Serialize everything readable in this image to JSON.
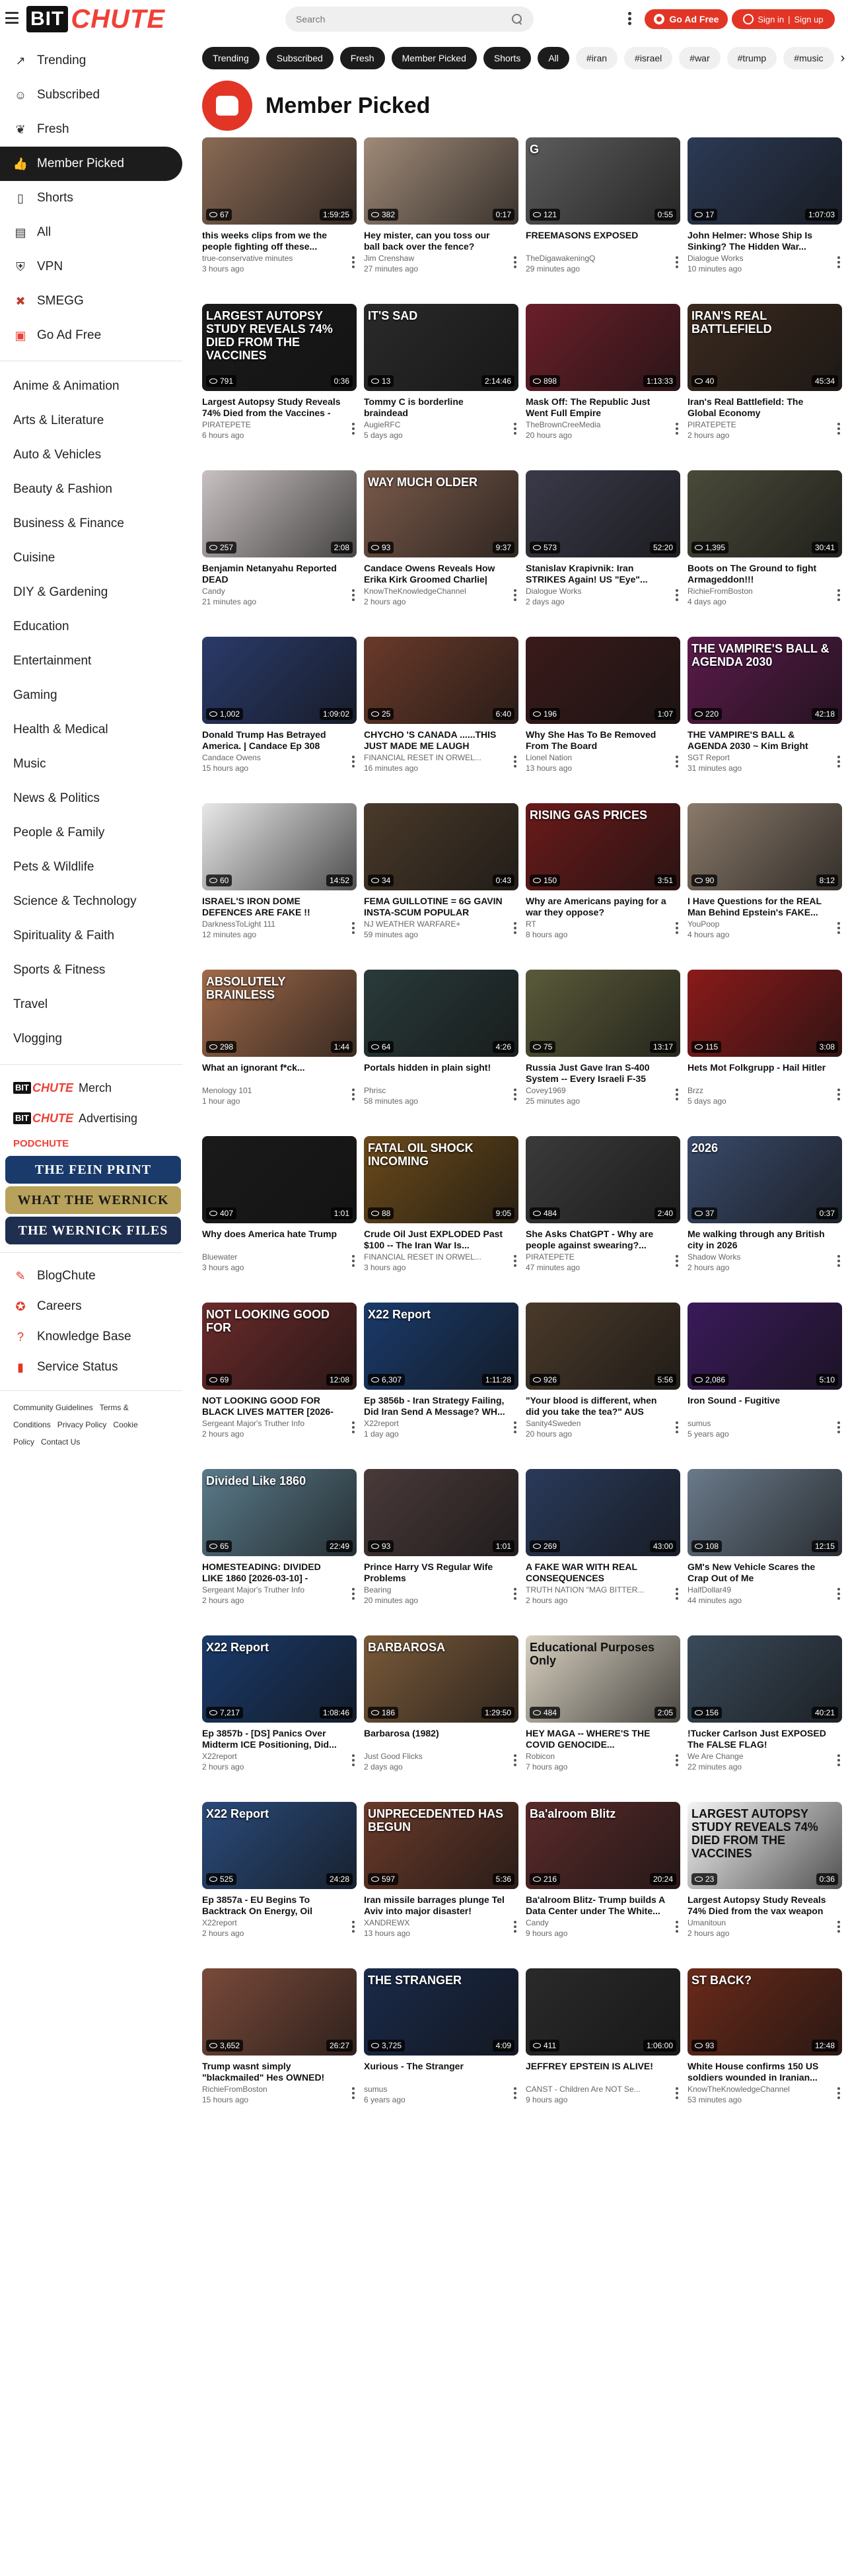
{
  "header": {
    "search_placeholder": "Search",
    "go_ad_free": "Go Ad Free",
    "sign_in": "Sign in",
    "separator": "|",
    "sign_up": "Sign up",
    "logo_text_a": "BIT",
    "logo_text_b": "CHUTE"
  },
  "sidebar": {
    "nav": [
      {
        "label": "Trending",
        "icon": "trending-icon"
      },
      {
        "label": "Subscribed",
        "icon": "person-icon"
      },
      {
        "label": "Fresh",
        "icon": "leaf-icon"
      },
      {
        "label": "Member Picked",
        "icon": "thumbs-up-icon"
      },
      {
        "label": "Shorts",
        "icon": "phone-icon"
      },
      {
        "label": "All",
        "icon": "document-icon"
      },
      {
        "label": "VPN",
        "icon": "shield-icon"
      },
      {
        "label": "SMEGG",
        "icon": "smegg-logo-icon"
      },
      {
        "label": "Go Ad Free",
        "icon": "bitchute-logo-icon"
      }
    ],
    "categories": [
      "Anime & Animation",
      "Arts & Literature",
      "Auto & Vehicles",
      "Beauty & Fashion",
      "Business & Finance",
      "Cuisine",
      "DIY & Gardening",
      "Education",
      "Entertainment",
      "Gaming",
      "Health & Medical",
      "Music",
      "News & Politics",
      "People & Family",
      "Pets & Wildlife",
      "Science & Technology",
      "Spirituality & Faith",
      "Sports & Fitness",
      "Travel",
      "Vlogging"
    ],
    "brand_links": [
      {
        "label": "Merch"
      },
      {
        "label": "Advertising"
      }
    ],
    "podchute": "PODCHUTE",
    "banners": [
      {
        "label": "THE FEIN PRINT",
        "color": "#1a3a6b"
      },
      {
        "label": "WHAT THE WERNICK",
        "color": "#b8a15a"
      },
      {
        "label": "THE WERNICK FILES",
        "color": "#1f2f4f"
      }
    ],
    "bottom_links": [
      {
        "label": "BlogChute",
        "icon": "blog-icon"
      },
      {
        "label": "Careers",
        "icon": "careers-icon"
      },
      {
        "label": "Knowledge Base",
        "icon": "help-icon"
      },
      {
        "label": "Service Status",
        "icon": "status-bars-icon"
      }
    ],
    "footer": [
      "Community Guidelines",
      "Terms & Conditions",
      "Privacy Policy",
      "Cookie Policy",
      "Contact Us"
    ]
  },
  "chips": [
    {
      "label": "Trending",
      "style": "dark"
    },
    {
      "label": "Subscribed",
      "style": "dark"
    },
    {
      "label": "Fresh",
      "style": "dark"
    },
    {
      "label": "Member Picked",
      "style": "dark"
    },
    {
      "label": "Shorts",
      "style": "dark"
    },
    {
      "label": "All",
      "style": "dark"
    },
    {
      "label": "#iran",
      "style": "plain"
    },
    {
      "label": "#israel",
      "style": "plain"
    },
    {
      "label": "#war",
      "style": "plain"
    },
    {
      "label": "#trump",
      "style": "plain"
    },
    {
      "label": "#music",
      "style": "plain"
    }
  ],
  "page_title": "Member Picked",
  "colors": {
    "accent": "#e23526",
    "dark": "#1c1c1c"
  },
  "videos": [
    {
      "title": "this weeks clips from we the people fighting off these...",
      "channel": "true-conservative minutes",
      "time": "3 hours ago",
      "views": "67",
      "duration": "1:59:25",
      "bg": "#8a6a55",
      "overlay": ""
    },
    {
      "title": "Hey mister, can you toss our ball back over the fence?",
      "channel": "Jim Crenshaw",
      "time": "27 minutes ago",
      "views": "382",
      "duration": "0:17",
      "bg": "#a08a78",
      "overlay": ""
    },
    {
      "title": "FREEMASONS EXPOSED",
      "channel": "TheDigawakeningQ",
      "time": "29 minutes ago",
      "views": "121",
      "duration": "0:55",
      "bg": "#5c5c5c",
      "overlay": "G"
    },
    {
      "title": "John Helmer: Whose Ship Is Sinking? The Hidden War...",
      "channel": "Dialogue Works",
      "time": "10 minutes ago",
      "views": "17",
      "duration": "1:07:03",
      "bg": "#2c3a55",
      "overlay": ""
    },
    {
      "title": "Largest Autopsy Study Reveals 74% Died from the Vaccines - D...",
      "channel": "PIRATEPETE",
      "time": "6 hours ago",
      "views": "791",
      "duration": "0:36",
      "bg": "#1a1a1a",
      "overlay": "LARGEST AUTOPSY STUDY REVEALS 74% DIED FROM THE VACCINES"
    },
    {
      "title": "Tommy C is borderline braindead",
      "channel": "AugieRFC",
      "time": "5 days ago",
      "views": "13",
      "duration": "2:14:46",
      "bg": "#2a2a2a",
      "overlay": "IT'S SAD"
    },
    {
      "title": "Mask Off: The Republic Just Went Full Empire",
      "channel": "TheBrownCreeMedia",
      "time": "20 hours ago",
      "views": "898",
      "duration": "1:13:33",
      "bg": "#6b1f2a",
      "overlay": ""
    },
    {
      "title": "Iran's Real Battlefield: The Global Economy",
      "channel": "PIRATEPETE",
      "time": "2 hours ago",
      "views": "40",
      "duration": "45:34",
      "bg": "#3b2a1f",
      "overlay": "IRAN'S REAL BATTLEFIELD"
    },
    {
      "title": "Benjamin Netanyahu Reported DEAD",
      "channel": "Candy",
      "time": "21 minutes ago",
      "views": "257",
      "duration": "2:08",
      "bg": "#c9c1c1",
      "overlay": ""
    },
    {
      "title": "Candace Owens Reveals How Erika Kirk Groomed Charlie| Eri...",
      "channel": "KnowTheKnowledgeChannel",
      "time": "2 hours ago",
      "views": "93",
      "duration": "9:37",
      "bg": "#7a5a4a",
      "overlay": "WAY MUCH OLDER"
    },
    {
      "title": "Stanislav Krapivnik: Iran STRIKES Again! US \"Eye\"...",
      "channel": "Dialogue Works",
      "time": "2 days ago",
      "views": "573",
      "duration": "52:20",
      "bg": "#3a3a4a",
      "overlay": ""
    },
    {
      "title": "Boots on The Ground to fight Armageddon!!!",
      "channel": "RichieFromBoston",
      "time": "4 days ago",
      "views": "1,395",
      "duration": "30:41",
      "bg": "#4a4a3a",
      "overlay": ""
    },
    {
      "title": "Donald Trump Has Betrayed America. | Candace Ep 308",
      "channel": "Candace Owens",
      "time": "15 hours ago",
      "views": "1,002",
      "duration": "1:09:02",
      "bg": "#2a3a6a",
      "overlay": ""
    },
    {
      "title": "CHYCHO 'S CANADA ......THIS JUST MADE ME LAUGH LIVING...",
      "channel": "FINANCIAL RESET IN ORWEL...",
      "time": "16 minutes ago",
      "views": "25",
      "duration": "6:40",
      "bg": "#6a3a2a",
      "overlay": ""
    },
    {
      "title": "Why She Has To Be Removed From The Board",
      "channel": "Lionel Nation",
      "time": "13 hours ago",
      "views": "196",
      "duration": "1:07",
      "bg": "#3a1a1a",
      "overlay": ""
    },
    {
      "title": "THE VAMPIRE'S BALL & AGENDA 2030 ~ Kim Bright",
      "channel": "SGT Report",
      "time": "31 minutes ago",
      "views": "220",
      "duration": "42:18",
      "bg": "#5a1a4a",
      "overlay": "THE VAMPIRE'S BALL & AGENDA 2030"
    },
    {
      "title": "ISRAEL'S IRON DOME DEFENCES ARE FAKE !!",
      "channel": "DarknessToLight 111",
      "time": "12 minutes ago",
      "views": "60",
      "duration": "14:52",
      "bg": "#e8e8e8",
      "overlay": ""
    },
    {
      "title": "FEMA GUILLOTINE = 6G GAVIN INSTA-SCUM POPULAR QUICK...",
      "channel": "NJ WEATHER WARFARE+",
      "time": "59 minutes ago",
      "views": "34",
      "duration": "0:43",
      "bg": "#4a3a2a",
      "overlay": ""
    },
    {
      "title": "Why are Americans paying for a war they oppose?",
      "channel": "RT",
      "time": "8 hours ago",
      "views": "150",
      "duration": "3:51",
      "bg": "#6a1a1a",
      "overlay": "RISING GAS PRICES"
    },
    {
      "title": "I Have Questions for the REAL Man Behind Epstein's FAKE...",
      "channel": "YouPoop",
      "time": "4 hours ago",
      "views": "90",
      "duration": "8:12",
      "bg": "#8a7a6a",
      "overlay": ""
    },
    {
      "title": "What an ignorant f*ck...",
      "channel": "Menology 101",
      "time": "1 hour ago",
      "views": "298",
      "duration": "1:44",
      "bg": "#a06a4a",
      "overlay": "ABSOLUTELY BRAINLESS"
    },
    {
      "title": "Portals hidden in plain sight!",
      "channel": "Phrisc",
      "time": "58 minutes ago",
      "views": "64",
      "duration": "4:26",
      "bg": "#2a3a3a",
      "overlay": ""
    },
    {
      "title": "Russia Just Gave Iran S-400 System -- Every Israeli F-35 No...",
      "channel": "Covey1969",
      "time": "25 minutes ago",
      "views": "75",
      "duration": "13:17",
      "bg": "#5a5a3a",
      "overlay": ""
    },
    {
      "title": "Hets Mot Folkgrupp - Hail Hitler",
      "channel": "Brzz",
      "time": "5 days ago",
      "views": "115",
      "duration": "3:08",
      "bg": "#8a1a1a",
      "overlay": ""
    },
    {
      "title": "Why does America hate Trump",
      "channel": "Bluewater",
      "time": "3 hours ago",
      "views": "407",
      "duration": "1:01",
      "bg": "#1a1a1a",
      "overlay": ""
    },
    {
      "title": "Crude Oil Just EXPLODED Past $100 -- The Iran War Is...",
      "channel": "FINANCIAL RESET IN ORWEL...",
      "time": "3 hours ago",
      "views": "88",
      "duration": "9:05",
      "bg": "#6a4a1a",
      "overlay": "FATAL OIL SHOCK INCOMING"
    },
    {
      "title": "She Asks ChatGPT - Why are people against swearing?...",
      "channel": "PIRATEPETE",
      "time": "47 minutes ago",
      "views": "484",
      "duration": "2:40",
      "bg": "#3a3a3a",
      "overlay": ""
    },
    {
      "title": "Me walking through any British city in 2026",
      "channel": "Shadow Works",
      "time": "2 hours ago",
      "views": "37",
      "duration": "0:37",
      "bg": "#3a4a6a",
      "overlay": "2026"
    },
    {
      "title": "NOT LOOKING GOOD FOR BLACK LIVES MATTER [2026-03-08] -...",
      "channel": "Sergeant Major's Truther Info",
      "time": "2 hours ago",
      "views": "69",
      "duration": "12:08",
      "bg": "#6a2a2a",
      "overlay": "NOT LOOKING GOOD FOR"
    },
    {
      "title": "Ep 3856b - Iran Strategy Failing, Did Iran Send A Message? WH...",
      "channel": "X22report",
      "time": "1 day ago",
      "views": "6,307",
      "duration": "1:11:28",
      "bg": "#1a3a6a",
      "overlay": "X22 Report"
    },
    {
      "title": "\"Your blood is different, when did you take the tea?\" AUS and...",
      "channel": "Sanity4Sweden",
      "time": "20 hours ago",
      "views": "926",
      "duration": "5:56",
      "bg": "#4a3a2a",
      "overlay": ""
    },
    {
      "title": "Iron Sound - Fugitive",
      "channel": "sumus",
      "time": "5 years ago",
      "views": "2,086",
      "duration": "5:10",
      "bg": "#3a1a5a",
      "overlay": ""
    },
    {
      "title": "HOMESTEADING: DIVIDED LIKE 1860 [2026-03-10] - PATARA...",
      "channel": "Sergeant Major's Truther Info",
      "time": "2 hours ago",
      "views": "65",
      "duration": "22:49",
      "bg": "#5a7a8a",
      "overlay": "Divided Like 1860"
    },
    {
      "title": "Prince Harry VS Regular Wife Problems",
      "channel": "Bearing",
      "time": "20 minutes ago",
      "views": "93",
      "duration": "1:01",
      "bg": "#4a3a3a",
      "overlay": ""
    },
    {
      "title": "A FAKE WAR WITH REAL CONSEQUENCES",
      "channel": "TRUTH NATION \"MAG BITTER...",
      "time": "2 hours ago",
      "views": "269",
      "duration": "43:00",
      "bg": "#2a3a5a",
      "overlay": ""
    },
    {
      "title": "GM's New Vehicle Scares the Crap Out of Me",
      "channel": "HalfDollar49",
      "time": "44 minutes ago",
      "views": "108",
      "duration": "12:15",
      "bg": "#6a7a8a",
      "overlay": ""
    },
    {
      "title": "Ep 3857b - [DS] Panics Over Midterm ICE Positioning, Did...",
      "channel": "X22report",
      "time": "2 hours ago",
      "views": "7,217",
      "duration": "1:08:46",
      "bg": "#1a3a6a",
      "overlay": "X22 Report"
    },
    {
      "title": "Barbarosa (1982)",
      "channel": "Just Good Flicks",
      "time": "2 days ago",
      "views": "186",
      "duration": "1:29:50",
      "bg": "#7a5a3a",
      "overlay": "BARBAROSA"
    },
    {
      "title": "HEY MAGA -- WHERE'S THE COVID GENOCIDE...",
      "channel": "Robicon",
      "time": "7 hours ago",
      "views": "484",
      "duration": "2:05",
      "bg": "#d8d0c0",
      "overlay": "Educational Purposes Only"
    },
    {
      "title": "!Tucker Carlson Just EXPOSED The FALSE FLAG!",
      "channel": "We Are Change",
      "time": "22 minutes ago",
      "views": "156",
      "duration": "40:21",
      "bg": "#3a4a5a",
      "overlay": ""
    },
    {
      "title": "Ep 3857a - EU Begins To Backtrack On Energy, Oil Drops,...",
      "channel": "X22report",
      "time": "2 hours ago",
      "views": "525",
      "duration": "24:28",
      "bg": "#2a4a7a",
      "overlay": "X22 Report"
    },
    {
      "title": "Iran missile barrages plunge Tel Aviv into major disaster!",
      "channel": "XANDREWX",
      "time": "13 hours ago",
      "views": "597",
      "duration": "5:36",
      "bg": "#6a3a2a",
      "overlay": "UNPRECEDENTED HAS BEGUN"
    },
    {
      "title": "Ba'alroom Blitz- Trump builds A Data Center under The White...",
      "channel": "Candy",
      "time": "9 hours ago",
      "views": "216",
      "duration": "20:24",
      "bg": "#5a2a2a",
      "overlay": "Ba'alroom Blitz"
    },
    {
      "title": "Largest Autopsy Study Reveals 74% Died from the vax weapon",
      "channel": "Umanitoun",
      "time": "2 hours ago",
      "views": "23",
      "duration": "0:36",
      "bg": "#f5f5f5",
      "overlay": "LARGEST AUTOPSY STUDY REVEALS 74% DIED FROM THE VACCINES"
    },
    {
      "title": "Trump wasnt simply \"blackmailed\" Hes OWNED! And...",
      "channel": "RichieFromBoston",
      "time": "15 hours ago",
      "views": "3,652",
      "duration": "26:27",
      "bg": "#7a4a3a",
      "overlay": ""
    },
    {
      "title": "Xurious - The Stranger",
      "channel": "sumus",
      "time": "6 years ago",
      "views": "3,725",
      "duration": "4:09",
      "bg": "#1a2a4a",
      "overlay": "THE STRANGER"
    },
    {
      "title": "JEFFREY EPSTEIN IS ALIVE!",
      "channel": "CANST - Children Are NOT Se...",
      "time": "9 hours ago",
      "views": "411",
      "duration": "1:06:00",
      "bg": "#2a2a2a",
      "overlay": ""
    },
    {
      "title": "White House confirms 150 US soldiers wounded in Iranian...",
      "channel": "KnowTheKnowledgeChannel",
      "time": "53 minutes ago",
      "views": "93",
      "duration": "12:48",
      "bg": "#6a2a1a",
      "overlay": "ST BACK?"
    }
  ]
}
